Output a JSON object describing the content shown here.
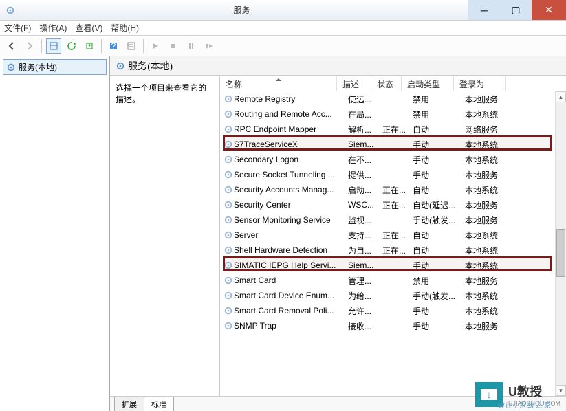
{
  "window": {
    "title": "服务"
  },
  "menu": {
    "file": "文件(F)",
    "action": "操作(A)",
    "view": "查看(V)",
    "help": "帮助(H)"
  },
  "tree": {
    "root": "服务(本地)"
  },
  "pane_header": "服务(本地)",
  "detail_prompt": "选择一个项目来查看它的描述。",
  "columns": {
    "name": "名称",
    "desc": "描述",
    "state": "状态",
    "start": "启动类型",
    "logon": "登录为"
  },
  "tabs": {
    "ext": "扩展",
    "std": "标准"
  },
  "services": [
    {
      "name": "Remote Registry",
      "desc": "使远...",
      "state": "",
      "start": "禁用",
      "logon": "本地服务"
    },
    {
      "name": "Routing and Remote Acc...",
      "desc": "在局...",
      "state": "",
      "start": "禁用",
      "logon": "本地系统"
    },
    {
      "name": "RPC Endpoint Mapper",
      "desc": "解析...",
      "state": "正在...",
      "start": "自动",
      "logon": "网络服务"
    },
    {
      "name": "S7TraceServiceX",
      "desc": "Siem...",
      "state": "",
      "start": "手动",
      "logon": "本地系统"
    },
    {
      "name": "Secondary Logon",
      "desc": "在不...",
      "state": "",
      "start": "手动",
      "logon": "本地系统"
    },
    {
      "name": "Secure Socket Tunneling ...",
      "desc": "提供...",
      "state": "",
      "start": "手动",
      "logon": "本地服务"
    },
    {
      "name": "Security Accounts Manag...",
      "desc": "启动...",
      "state": "正在...",
      "start": "自动",
      "logon": "本地系统"
    },
    {
      "name": "Security Center",
      "desc": "WSC...",
      "state": "正在...",
      "start": "自动(延迟...",
      "logon": "本地服务"
    },
    {
      "name": "Sensor Monitoring Service",
      "desc": "监视...",
      "state": "",
      "start": "手动(触发...",
      "logon": "本地服务"
    },
    {
      "name": "Server",
      "desc": "支持...",
      "state": "正在...",
      "start": "自动",
      "logon": "本地系统"
    },
    {
      "name": "Shell Hardware Detection",
      "desc": "为自...",
      "state": "正在...",
      "start": "自动",
      "logon": "本地系统"
    },
    {
      "name": "SIMATIC IEPG Help Servi...",
      "desc": "Siem...",
      "state": "",
      "start": "手动",
      "logon": "本地系统"
    },
    {
      "name": "Smart Card",
      "desc": "管理...",
      "state": "",
      "start": "禁用",
      "logon": "本地服务"
    },
    {
      "name": "Smart Card Device Enum...",
      "desc": "为给...",
      "state": "",
      "start": "手动(触发...",
      "logon": "本地系统"
    },
    {
      "name": "Smart Card Removal Poli...",
      "desc": "允许...",
      "state": "",
      "start": "手动",
      "logon": "本地系统"
    },
    {
      "name": "SNMP Trap",
      "desc": "接收...",
      "state": "",
      "start": "手动",
      "logon": "本地服务"
    }
  ],
  "watermark": {
    "brand": "U教授",
    "sub": "UJIAOSHOU.COM",
    "wm2": "Win7系统之家"
  }
}
